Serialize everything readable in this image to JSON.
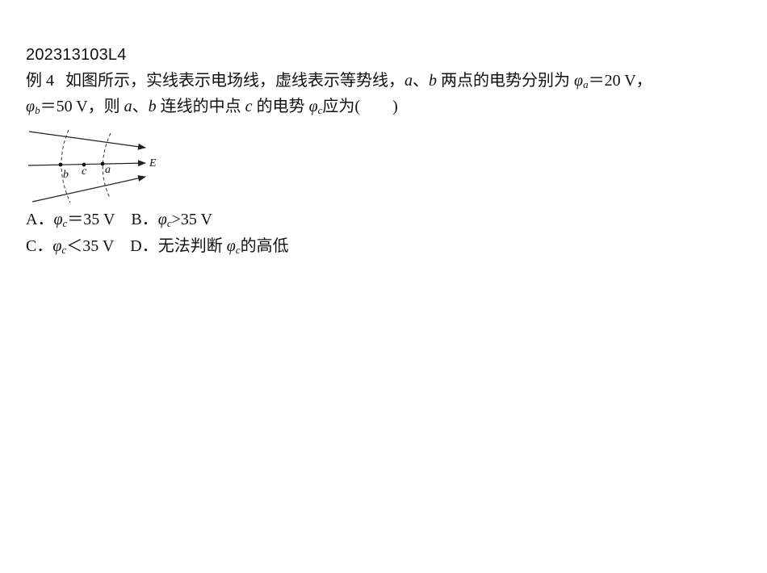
{
  "question_id": "202313103L4",
  "question": {
    "example_label": "例 4",
    "line1": {
      "text_a": "如图所示，实线表示电场线，虚线表示等势线，",
      "a": "a",
      "sep": "、",
      "b": "b",
      "text_b": " 两点的电势分别为 ",
      "phi": "φ",
      "sub_a": "a",
      "value_a": "＝20 V，"
    },
    "line2": {
      "phi": "φ",
      "sub_b": "b",
      "value_b": "＝50 V，则 ",
      "a": "a",
      "sep": "、",
      "b": "b",
      "text_c": " 连线的中点 ",
      "c": "c",
      "text_d": " 的电势 ",
      "phi2": "φ",
      "sub_c": "c",
      "text_e": "应为(",
      "close": ")"
    }
  },
  "figure": {
    "field_label": "E",
    "point_b": "b",
    "point_c": "c",
    "point_a": "a"
  },
  "options": {
    "A": {
      "label": "A．",
      "phi": "φ",
      "sub": "c",
      "rest": "＝35 V"
    },
    "B": {
      "label": "B．",
      "phi": "φ",
      "sub": "c",
      "rest": ">35 V"
    },
    "C": {
      "label": "C．",
      "phi": "φ",
      "sub": "c",
      "rest": "＜35 V"
    },
    "D": {
      "label": "D．",
      "text": "无法判断 ",
      "phi": "φ",
      "sub": "c",
      "rest": "的高低"
    }
  }
}
